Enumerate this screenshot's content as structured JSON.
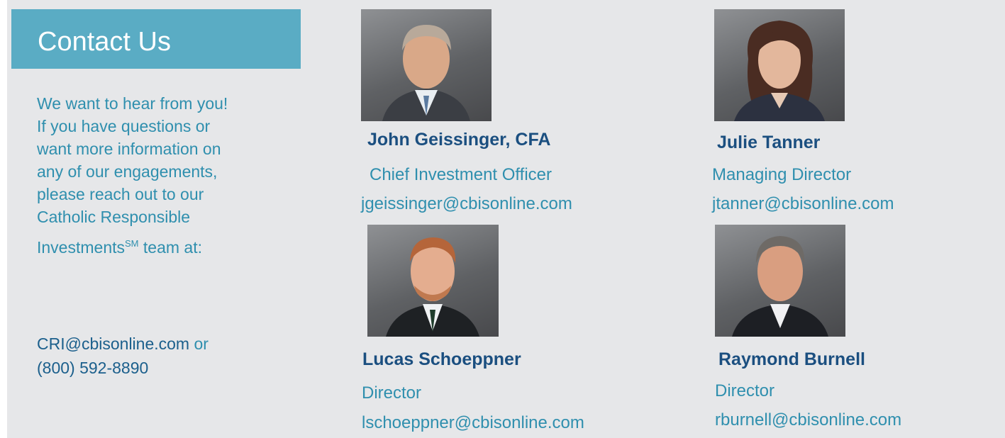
{
  "header": {
    "title": "Contact Us"
  },
  "intro": {
    "lines": [
      "We want to hear from you!",
      "If you have questions or",
      "want more information on",
      "any of our engagements,",
      "please reach out to our",
      "Catholic Responsible"
    ],
    "last_line_prefix": "Investments",
    "last_line_sup": "SM",
    "last_line_suffix": " team at:"
  },
  "contact": {
    "email": "CRI@cbisonline.com",
    "or_text": " or",
    "phone": "(800) 592-8890"
  },
  "people": [
    {
      "name": "John Geissinger, CFA",
      "title": "Chief Investment Officer",
      "email": "jgeissinger@cbisonline.com"
    },
    {
      "name": "Julie Tanner",
      "title": "Managing Director",
      "email": "jtanner@cbisonline.com"
    },
    {
      "name": "Lucas Schoeppner",
      "title": "Director",
      "email": "lschoeppner@cbisonline.com"
    },
    {
      "name": "Raymond Burnell",
      "title": "Director",
      "email": "rburnell@cbisonline.com"
    }
  ],
  "colors": {
    "header_bg": "#5aacc4",
    "panel_bg": "#e6e7e9",
    "name_color": "#1b4f80",
    "text_color": "#2f8fae"
  }
}
